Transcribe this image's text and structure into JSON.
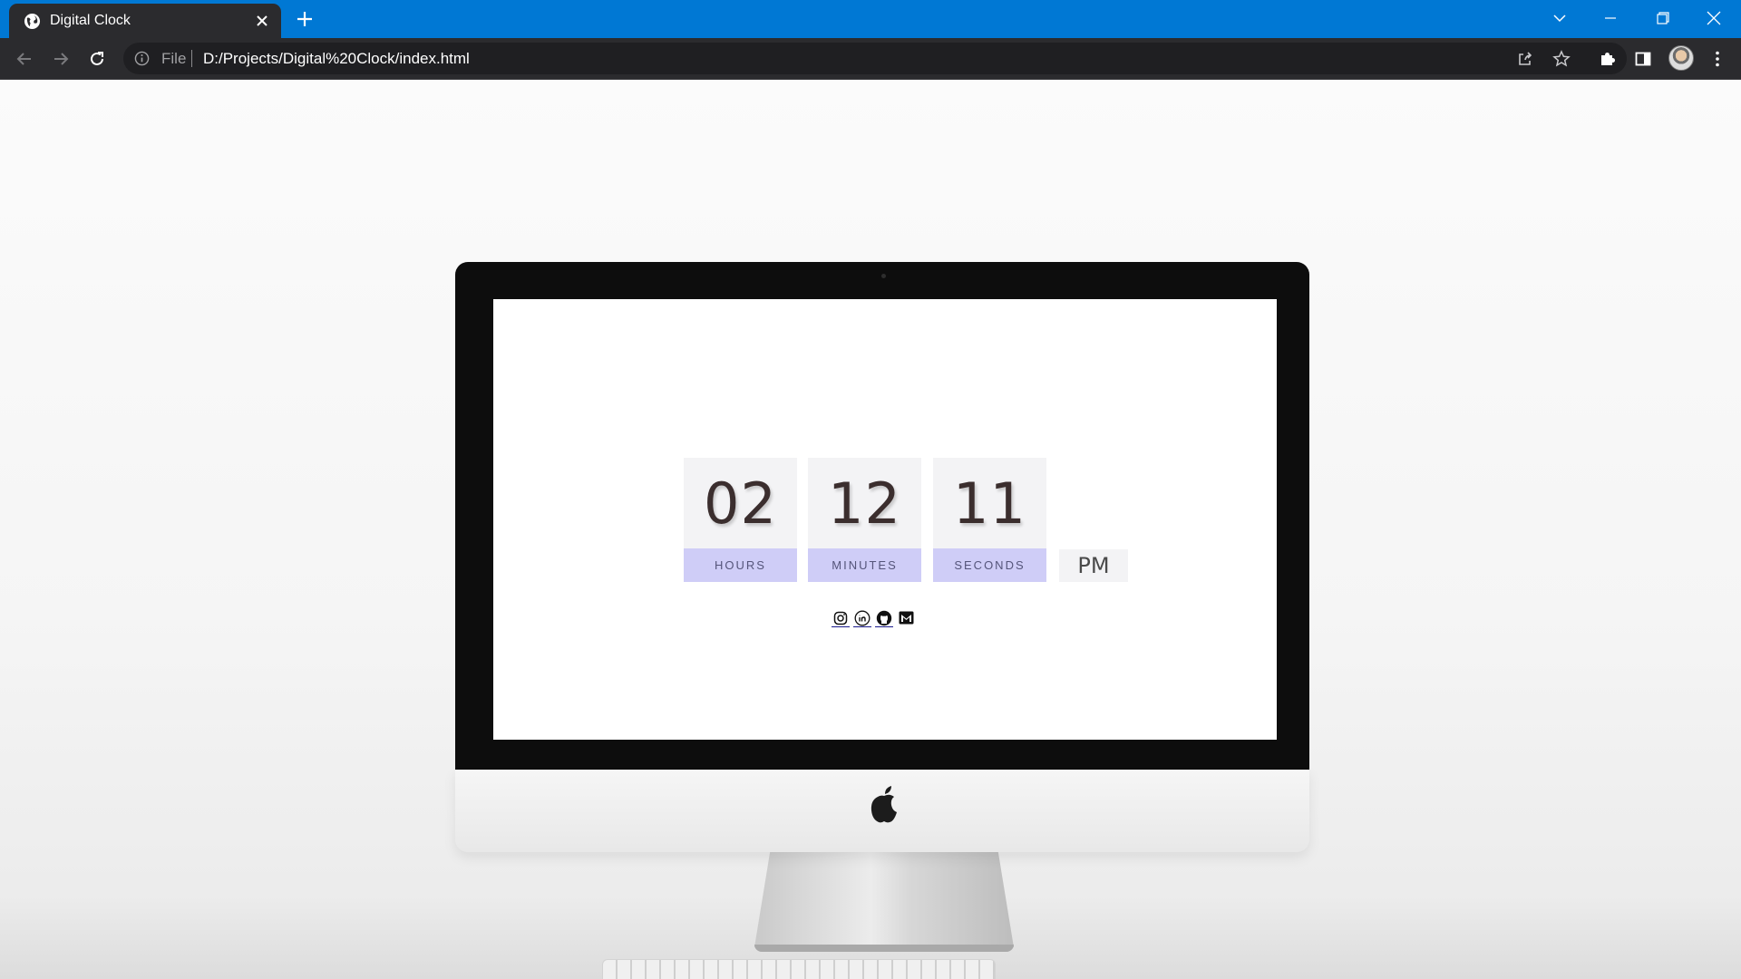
{
  "browser": {
    "tab_title": "Digital Clock",
    "url_scheme": "File",
    "url": "D:/Projects/Digital%20Clock/index.html"
  },
  "clock": {
    "units": [
      {
        "value": "02",
        "label": "HOURS"
      },
      {
        "value": "12",
        "label": "MINUTES"
      },
      {
        "value": "11",
        "label": "SECONDS"
      }
    ],
    "meridiem": "PM",
    "social_links": [
      "instagram-icon",
      "linkedin-icon",
      "github-icon",
      "gmail-icon"
    ]
  },
  "colors": {
    "tabstrip": "#0078d4",
    "chrome_dark": "#2b2b2e",
    "label_bg": "#cfcdf7",
    "digit_bg": "#f3f3f5",
    "digit_text": "#3b2e2e"
  }
}
